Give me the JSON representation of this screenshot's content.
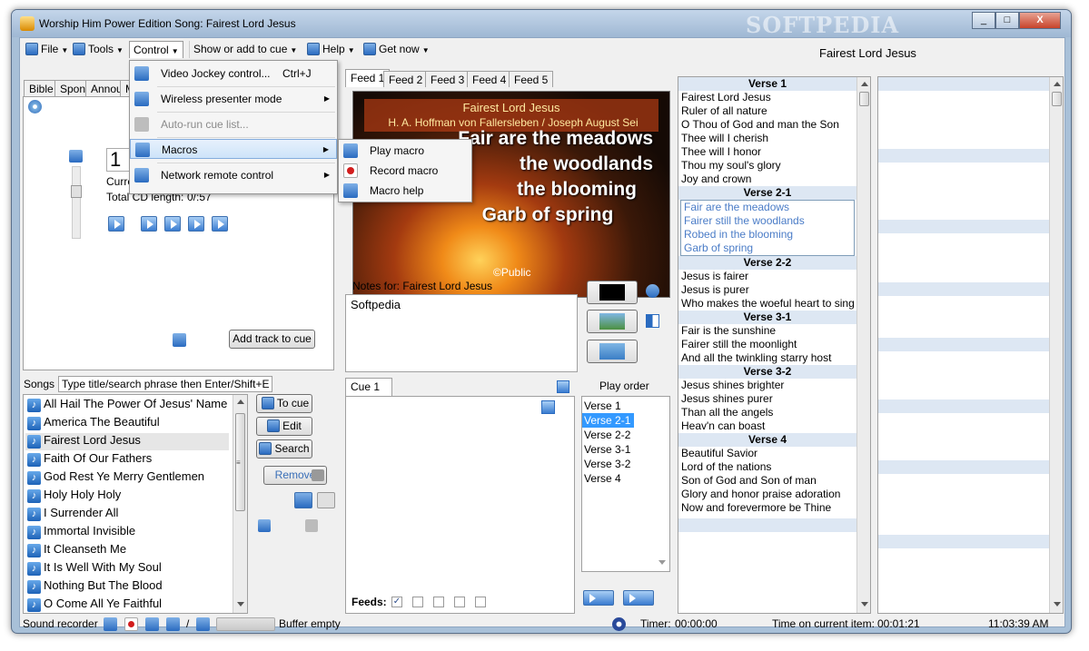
{
  "window": {
    "title": "Worship Him Power Edition Song: Fairest Lord Jesus",
    "watermark": "SOFTPEDIA",
    "controls": [
      "_",
      "□",
      "X"
    ]
  },
  "menubar": {
    "items": [
      {
        "label": "File"
      },
      {
        "label": "Tools"
      },
      {
        "label": "Control"
      },
      {
        "label": "Show or add to cue"
      },
      {
        "label": "Help"
      },
      {
        "label": "Get now"
      }
    ],
    "song_title": "Fairest Lord Jesus"
  },
  "left_tabs": [
    "Bible",
    "Spont",
    "Annou",
    "M"
  ],
  "cd": {
    "digit": "1",
    "current_label": "Curre",
    "total_label": "Total CD length:",
    "total_value": "0/:57",
    "add_track_label": "Add track to cue"
  },
  "control_menu": {
    "items": [
      {
        "label": "Video Jockey control...",
        "shortcut": "Ctrl+J",
        "submenu": false,
        "disabled": false
      },
      {
        "label": "Wireless presenter mode",
        "shortcut": "",
        "submenu": true,
        "disabled": false
      },
      {
        "label": "Auto-run cue list...",
        "shortcut": "",
        "submenu": false,
        "disabled": true
      },
      {
        "label": "Macros",
        "shortcut": "",
        "submenu": true,
        "disabled": false
      },
      {
        "label": "Network remote control",
        "shortcut": "",
        "submenu": true,
        "disabled": false
      }
    ]
  },
  "macros_menu": {
    "items": [
      {
        "label": "Play macro",
        "icon": "play-icon"
      },
      {
        "label": "Record macro",
        "icon": "record-icon"
      },
      {
        "label": "Macro help",
        "icon": "help-icon"
      }
    ]
  },
  "feeds": {
    "tabs": [
      "Feed 1",
      "Feed 2",
      "Feed 3",
      "Feed 4",
      "Feed 5"
    ],
    "preview": {
      "title": "Fairest Lord Jesus",
      "author": "H. A. Hoffman von Fallersleben / Joseph August Sei",
      "lines": [
        "Fair are the meadows",
        "Fairer still the woodlands",
        "Robed in the blooming",
        "Garb of spring"
      ],
      "visible_fragments": [
        "Fair are the meadows",
        "the woodlands",
        "the blooming",
        "Garb of spring"
      ],
      "copyright": "©Public"
    }
  },
  "notes": {
    "label": "Notes for: Fairest Lord Jesus",
    "value": "Softpedia"
  },
  "songs": {
    "label": "Songs",
    "search_placeholder": "Type title/search phrase then Enter/Shift+E",
    "items": [
      "All Hail The Power Of Jesus' Name",
      "America The Beautiful",
      "Fairest Lord Jesus",
      "Faith Of Our Fathers",
      "God Rest Ye Merry Gentlemen",
      "Holy Holy Holy",
      "I Surrender All",
      "Immortal Invisible",
      "It Cleanseth Me",
      "It Is Well With My Soul",
      "Nothing But The Blood",
      "O Come All Ye Faithful"
    ],
    "selected_index": 2,
    "buttons": {
      "to_cue": "To cue",
      "edit": "Edit",
      "search": "Search",
      "remove": "Remove"
    }
  },
  "cue": {
    "tab_label": "Cue 1",
    "feeds_label": "Feeds:",
    "feed_checks": [
      true,
      false,
      false,
      false,
      false
    ]
  },
  "play_order": {
    "label": "Play order",
    "items": [
      "Verse 1",
      "Verse 2-1",
      "Verse 2-2",
      "Verse 3-1",
      "Verse 3-2",
      "Verse 4"
    ],
    "selected_index": 1
  },
  "verses": [
    {
      "heading": "Verse 1",
      "lines": [
        "Fairest Lord Jesus",
        "Ruler of all nature",
        "O Thou of God and man the Son",
        "Thee will I cherish",
        "Thee will I honor",
        "Thou my soul's glory",
        "Joy and crown"
      ],
      "selected": false
    },
    {
      "heading": "Verse 2-1",
      "lines": [
        "Fair are the meadows",
        "Fairer still the woodlands",
        "Robed in the blooming",
        "Garb of spring"
      ],
      "selected": true
    },
    {
      "heading": "Verse 2-2",
      "lines": [
        "Jesus is fairer",
        "Jesus is purer",
        "Who makes the woeful heart to sing"
      ],
      "selected": false
    },
    {
      "heading": "Verse 3-1",
      "lines": [
        "Fair is the sunshine",
        "Fairer still the moonlight",
        "And all the twinkling starry host"
      ],
      "selected": false
    },
    {
      "heading": "Verse 3-2",
      "lines": [
        "Jesus shines brighter",
        "Jesus shines purer",
        "Than all the angels",
        "Heav'n can boast"
      ],
      "selected": false
    },
    {
      "heading": "Verse 4",
      "lines": [
        "Beautiful Savior",
        "Lord of the nations",
        "Son of God and Son of man",
        "Glory and honor praise adoration",
        "Now and forevermore be Thine"
      ],
      "selected": false
    }
  ],
  "status": {
    "sound_recorder": "Sound recorder",
    "slash": "/",
    "buffer": "Buffer empty",
    "timer_label": "Timer:",
    "timer_value": "00:00:00",
    "time_on_item_label": "Time on current item:",
    "time_on_item_value": "00:01:21",
    "clock": "11:03:39 AM"
  }
}
